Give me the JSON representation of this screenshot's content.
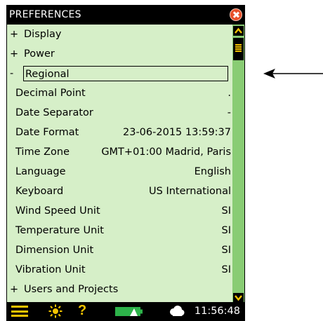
{
  "window": {
    "title": "PREFERENCES"
  },
  "categories_top": [
    {
      "prefix": "+",
      "label": "Display"
    },
    {
      "prefix": "+",
      "label": "Power"
    },
    {
      "prefix": "-",
      "label": "Regional"
    }
  ],
  "settings": [
    {
      "label": "Decimal Point",
      "value": "."
    },
    {
      "label": "Date Separator",
      "value": "-"
    },
    {
      "label": "Date Format",
      "value": "23-06-2015 13:59:37"
    },
    {
      "label": "Time Zone",
      "value": "GMT+01:00 Madrid, Paris"
    },
    {
      "label": "Language",
      "value": "English"
    },
    {
      "label": "Keyboard",
      "value": "US International"
    },
    {
      "label": "Wind Speed Unit",
      "value": "SI"
    },
    {
      "label": "Temperature Unit",
      "value": "SI"
    },
    {
      "label": "Dimension Unit",
      "value": "SI"
    },
    {
      "label": "Vibration Unit",
      "value": "SI"
    }
  ],
  "categories_bottom": [
    {
      "prefix": "+",
      "label": "Users and Projects"
    }
  ],
  "statusbar": {
    "help_label": "?",
    "time": "11:56:48"
  },
  "colors": {
    "background": "#d6efc8",
    "scrollbar": "#89cc74",
    "accent_yellow": "#f5c400",
    "close_red": "#e8502a",
    "battery_green": "#2db34a"
  },
  "icons": [
    "close-icon",
    "scroll-up-icon",
    "scroll-down-icon",
    "menu-icon",
    "sun-icon",
    "help-icon",
    "battery-icon",
    "cloud-icon",
    "arrow-left-icon"
  ]
}
